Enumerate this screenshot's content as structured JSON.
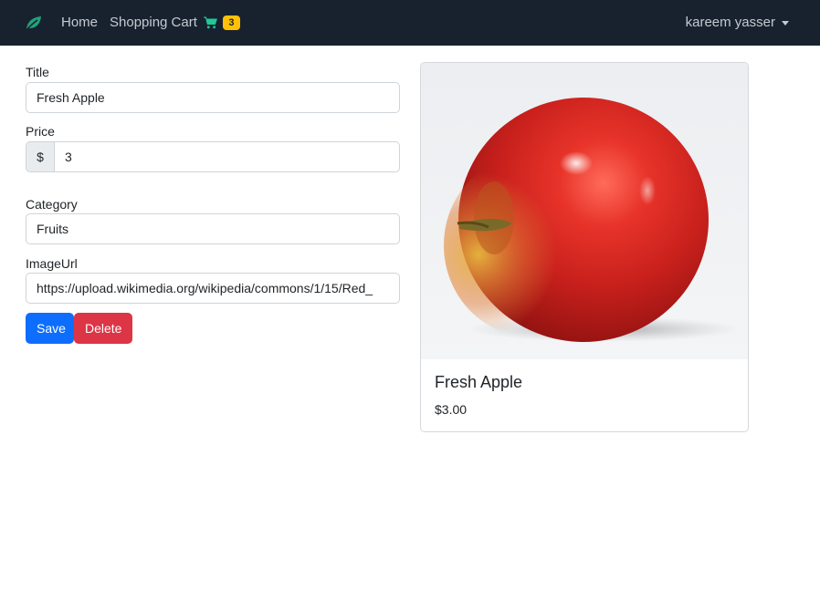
{
  "navbar": {
    "brand_icon": "leaf-icon",
    "home_label": "Home",
    "cart_label": "Shopping Cart",
    "cart_icon": "cart-icon",
    "cart_count": "3",
    "user_name": "kareem yasser",
    "colors": {
      "background": "#18222f",
      "brand": "#20a37a",
      "cart_icon": "#20c997",
      "badge": "#ffc107"
    }
  },
  "form": {
    "title_label": "Title",
    "title_value": "Fresh Apple",
    "price_label": "Price",
    "price_prefix": "$",
    "price_value": "3",
    "category_label": "Category",
    "category_value": "Fruits",
    "image_label": "ImageUrl",
    "image_value": "https://upload.wikimedia.org/wikipedia/commons/1/15/Red_",
    "save_label": "Save",
    "delete_label": "Delete",
    "colors": {
      "save": "#0d6efd",
      "delete": "#dc3545"
    }
  },
  "card": {
    "image_alt": "red-apple-photo",
    "title": "Fresh Apple",
    "price": "$3.00"
  }
}
